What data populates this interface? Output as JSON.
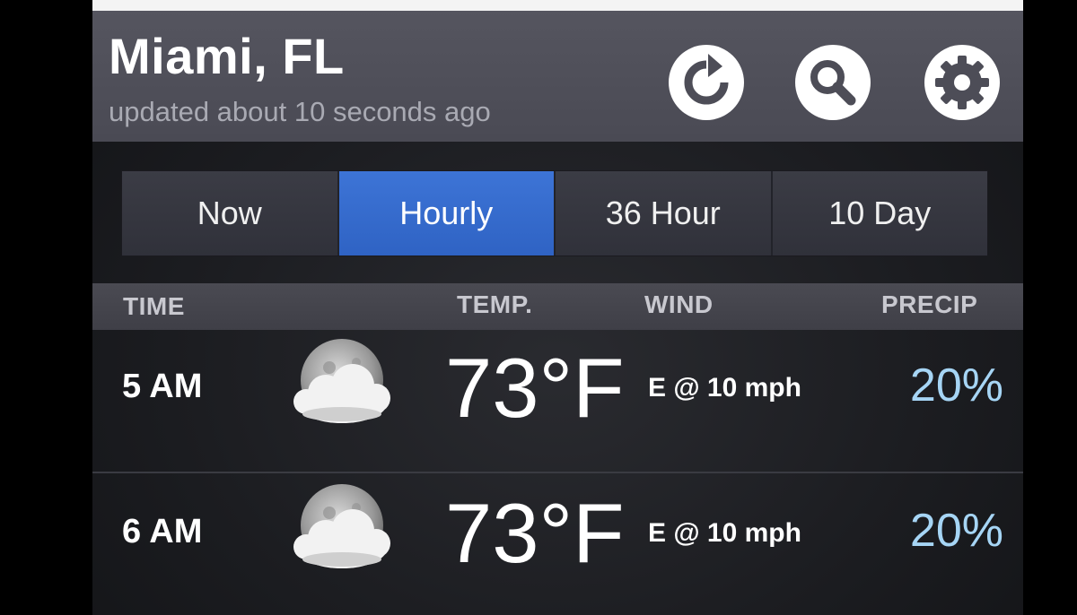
{
  "header": {
    "city": "Miami, FL",
    "updated": "updated about 10 seconds ago",
    "buttons": [
      {
        "name": "refresh",
        "icon": "refresh-icon"
      },
      {
        "name": "search",
        "icon": "search-icon"
      },
      {
        "name": "settings",
        "icon": "gear-icon"
      }
    ]
  },
  "tabs": [
    {
      "label": "Now",
      "active": false
    },
    {
      "label": "Hourly",
      "active": true
    },
    {
      "label": "36 Hour",
      "active": false
    },
    {
      "label": "10 Day",
      "active": false
    }
  ],
  "columns": {
    "time": "TIME",
    "temp": "TEMP.",
    "wind": "WIND",
    "precip": "PRECIP"
  },
  "rows": [
    {
      "time": "5 AM",
      "icon": "partly-cloudy-night-icon",
      "temp": "73°F",
      "wind": "E @ 10 mph",
      "precip": "20%"
    },
    {
      "time": "6 AM",
      "icon": "partly-cloudy-night-icon",
      "temp": "73°F",
      "wind": "E @ 10 mph",
      "precip": "20%"
    }
  ],
  "colors": {
    "active_tab": "#3469cc",
    "precip": "#a6d5f5",
    "header_bg": "#4f4f59"
  }
}
